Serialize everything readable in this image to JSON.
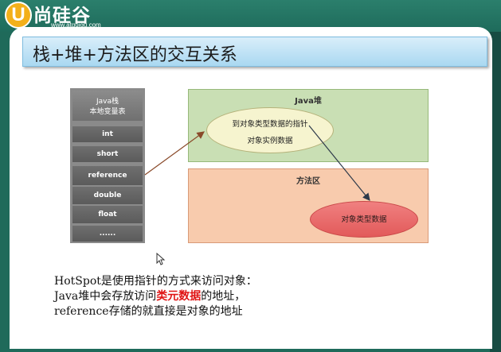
{
  "brand": {
    "logo_letter": "U",
    "name": "尚硅谷",
    "url": "www.atguigu.com"
  },
  "slide": {
    "title": "栈+堆+方法区的交互关系"
  },
  "stack": {
    "header_line1": "Java栈",
    "header_line2": "本地变量表",
    "cells": [
      "int",
      "short",
      "reference",
      "double",
      "float",
      "......"
    ]
  },
  "heap": {
    "label": "Java堆",
    "pointer_text": "到对象类型数据的指针",
    "instance_text": "对象实例数据"
  },
  "method_area": {
    "label": "方法区",
    "class_data_text": "对象类型数据"
  },
  "notes": {
    "line1": "HotSpot是使用指针的方式来访问对象：",
    "line2_pre": "Java堆中会存放访问",
    "line2_highlight": "类元数据",
    "line2_post": "的地址，",
    "line3": "reference存储的就直接是对象的地址"
  },
  "colors": {
    "heap_bg": "#c9dfb4",
    "method_bg": "#f8cbad",
    "class_data_ellipse": "#e25a5a",
    "highlight": "#e01515",
    "title_bg": "#a9d8f1"
  }
}
